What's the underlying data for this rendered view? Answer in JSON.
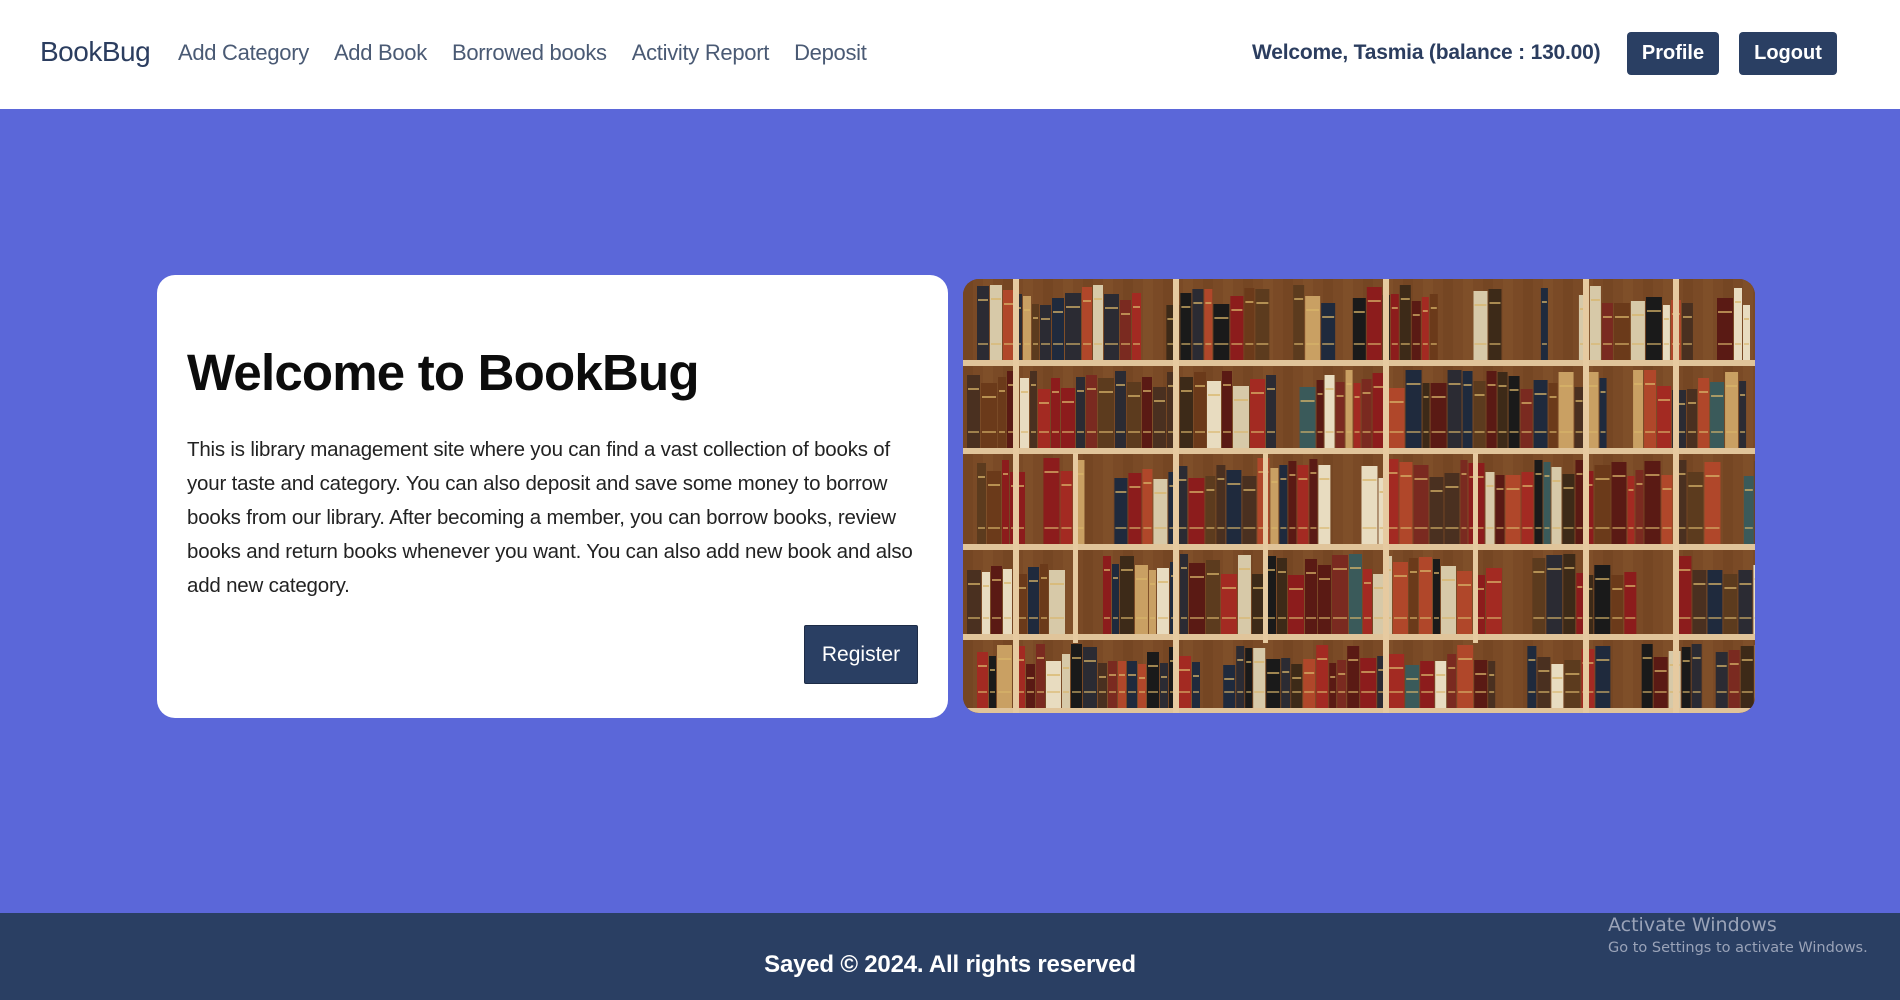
{
  "navbar": {
    "brand": "BookBug",
    "links": [
      "Add Category",
      "Add Book",
      "Borrowed books",
      "Activity Report",
      "Deposit"
    ],
    "welcome": "Welcome, Tasmia (balance : 130.00)",
    "profile_label": "Profile",
    "logout_label": "Logout"
  },
  "hero": {
    "title": "Welcome to BookBug",
    "description": "This is library management site where you can find a vast collection of books of your taste and category. You can also deposit and save some money to borrow books from our library. After becoming a member, you can borrow books, review books and return books whenever you want. You can also add new book and also add new category.",
    "register_label": "Register",
    "image_icon": "bookshelf-image"
  },
  "footer": {
    "copyright": "Sayed © 2024. All rights reserved"
  },
  "watermark": {
    "line1": "Activate Windows",
    "line2": "Go to Settings to activate Windows."
  },
  "colors": {
    "page_background": "#5b67d9",
    "primary": "#2a3f63",
    "card": "#ffffff"
  }
}
